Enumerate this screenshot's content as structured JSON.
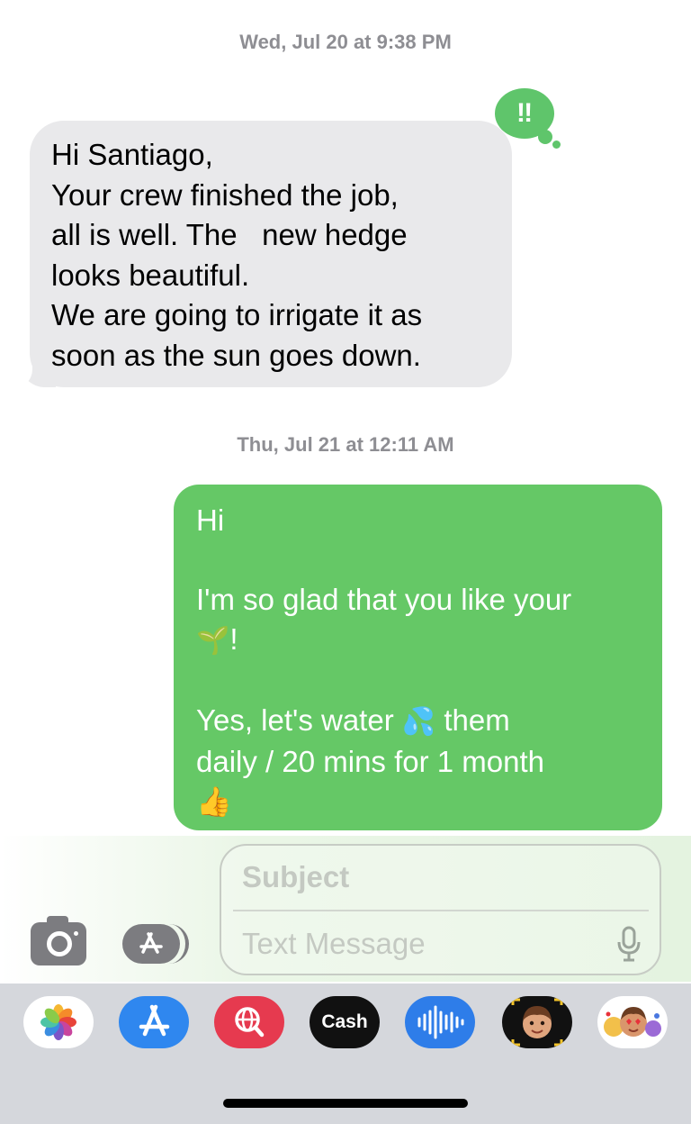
{
  "timestamps": {
    "first": "Wed, Jul 20 at 9:38 PM",
    "second": "Thu, Jul 21 at 12:11 AM"
  },
  "received_message": {
    "lines": [
      "Hi Santiago,",
      "Your crew finished the job,",
      "all is well. The   new hedge",
      "looks beautiful.",
      "We are going to irrigate it as",
      "soon as the sun goes down."
    ],
    "reaction": "‼"
  },
  "sent_message": {
    "line1": "Hi",
    "line3": "I'm so glad that you like your",
    "line4_emoji": "🌱",
    "line4_text": "!",
    "line6_before": "Yes, let's water ",
    "line6_emoji": "💦",
    "line6_after": " them",
    "line7": "daily / 20 mins for 1 month",
    "line8_emoji": "👍"
  },
  "compose": {
    "subject_placeholder": "Subject",
    "message_placeholder": "Text Message"
  },
  "apps": {
    "apple_cash_label": "Cash",
    "apple_cash_logo": ""
  },
  "colors": {
    "sent_bubble": "#65c866",
    "received_bubble": "#e9e9eb",
    "reaction": "#5fc56b"
  }
}
